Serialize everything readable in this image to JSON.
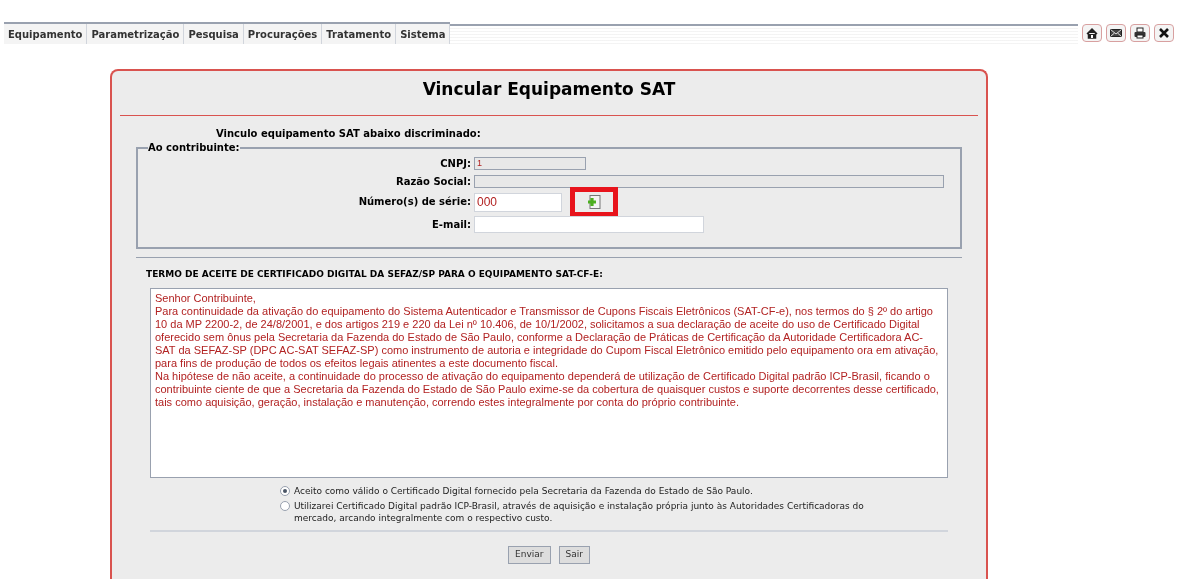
{
  "menu_tabs": [
    {
      "label": "Equipamento",
      "selected": false
    },
    {
      "label": "Parametrização",
      "selected": false
    },
    {
      "label": "Pesquisa",
      "selected": false
    },
    {
      "label": "Procurações",
      "selected": false
    },
    {
      "label": "Tratamento",
      "selected": false
    },
    {
      "label": "Sistema",
      "selected": false
    }
  ],
  "toolbar": [
    {
      "kind": "home"
    },
    {
      "kind": "mail"
    },
    {
      "kind": "print"
    },
    {
      "kind": "close"
    }
  ],
  "form": {
    "title": "Vincular Equipamento SAT",
    "intro": "Vinculo equipamento SAT abaixo discriminado:",
    "legend": "Ao contribuinte:",
    "fields": [
      {
        "kind": "short",
        "label": "CNPJ:",
        "value": "1",
        "disabled": true
      },
      {
        "kind": "long",
        "label": "Razão Social:",
        "disabled": true
      },
      {
        "kind": "serial",
        "label": "Número(s) de série:",
        "value": "000",
        "disabled": false,
        "highlighted": true
      },
      {
        "kind": "email",
        "label": "E-mail:",
        "disabled": false
      }
    ],
    "term_heading": "TERMO DE ACEITE DE CERTIFICADO DIGITAL DA SEFAZ/SP PARA O EQUIPAMENTO SAT-CF-E:",
    "term_text": [
      "Senhor Contribuinte,",
      "Para continuidade da ativação do equipamento do Sistema Autenticador e Transmissor de Cupons Fiscais Eletrônicos (SAT-CF-e), nos termos do § 2º do artigo 10 da MP 2200-2, de 24/8/2001, e dos artigos 219 e 220 da Lei nº 10.406, de 10/1/2002, solicitamos a sua declaração de aceite do uso de Certificado Digital oferecido sem ônus pela Secretaria da Fazenda do Estado de São Paulo, conforme a Declaração de Práticas de Certificação da Autoridade Certificadora AC-SAT da SEFAZ-SP (DPC AC-SAT SEFAZ-SP) como instrumento de autoria e integridade do Cupom Fiscal Eletrônico emitido pelo equipamento ora em ativação, para fins de produção de todos os efeitos legais atinentes a este documento fiscal.",
      "Na hipótese de não aceite, a continuidade do processo de ativação do equipamento dependerá de utilização de Certificado Digital padrão ICP-Brasil, ficando o contribuinte ciente de que a Secretaria da Fazenda do Estado de São Paulo exime-se da cobertura de quaisquer custos e suporte decorrentes desse certificado, tais como aquisição, geração, instalação e manutenção, correndo estes integralmente por conta do próprio contribuinte."
    ],
    "options": [
      {
        "label": "Aceito como válido o Certificado Digital fornecido pela Secretaria da Fazenda do Estado de São Paulo.",
        "selected": true
      },
      {
        "label": "Utilizarei Certificado Digital padrão ICP-Brasil, através de aquisição e instalação própria junto às Autoridades Certificadoras do mercado, arcando integralmente com o respectivo custo.",
        "selected": false
      }
    ],
    "buttons": [
      "Enviar",
      "Sair"
    ]
  }
}
